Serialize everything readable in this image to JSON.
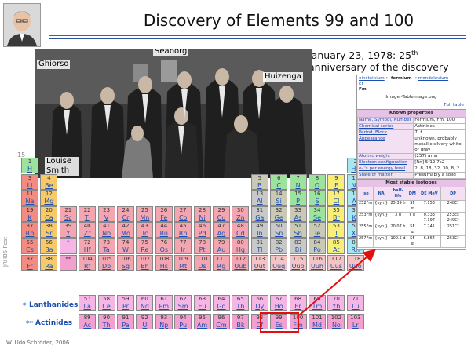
{
  "title": "Discovery of Elements 99 and 100",
  "anniversary": {
    "line1": "January 23, 1978: 25",
    "sup": "th",
    "line2": "anniversary of the discovery"
  },
  "photo_labels": {
    "ghiorso": "Ghiorso",
    "seaborg": "Seaborg",
    "huizenga": "Huizenga",
    "louise_smith": "Louise Smith"
  },
  "group_label": "15",
  "lanthanides_label": "Lanthanides",
  "actinides_label": "Actinides",
  "lanthanides_star": "*",
  "actinides_star": "**",
  "side_label": "JRH85-Fest",
  "credit": "W. Udo Schröder, 2006",
  "colors": {
    "accent_rule": "#c0303a",
    "rule2": "#3050a0",
    "highlight": "#e01010"
  },
  "elements": [
    {
      "n": "1",
      "s": "H",
      "c": "c-h",
      "col": 0,
      "row": 0
    },
    {
      "n": "2",
      "s": "He",
      "c": "c-ng",
      "col": 17,
      "row": 0
    },
    {
      "n": "3",
      "s": "Li",
      "c": "c-alk",
      "col": 0,
      "row": 1
    },
    {
      "n": "4",
      "s": "Be",
      "c": "c-ae",
      "col": 1,
      "row": 1
    },
    {
      "n": "5",
      "s": "B",
      "c": "c-met",
      "col": 12,
      "row": 1
    },
    {
      "n": "6",
      "s": "C",
      "c": "c-nm",
      "col": 13,
      "row": 1
    },
    {
      "n": "7",
      "s": "N",
      "c": "c-nm",
      "col": 14,
      "row": 1
    },
    {
      "n": "8",
      "s": "O",
      "c": "c-nm",
      "col": 15,
      "row": 1
    },
    {
      "n": "9",
      "s": "F",
      "c": "c-hal",
      "col": 16,
      "row": 1
    },
    {
      "n": "10",
      "s": "Ne",
      "c": "c-ng",
      "col": 17,
      "row": 1
    },
    {
      "n": "11",
      "s": "Na",
      "c": "c-alk",
      "col": 0,
      "row": 2
    },
    {
      "n": "12",
      "s": "Mg",
      "c": "c-ae",
      "col": 1,
      "row": 2
    },
    {
      "n": "13",
      "s": "Al",
      "c": "c-ptm",
      "col": 12,
      "row": 2
    },
    {
      "n": "14",
      "s": "Si",
      "c": "c-met",
      "col": 13,
      "row": 2
    },
    {
      "n": "15",
      "s": "P",
      "c": "c-nm",
      "col": 14,
      "row": 2
    },
    {
      "n": "16",
      "s": "S",
      "c": "c-nm",
      "col": 15,
      "row": 2
    },
    {
      "n": "17",
      "s": "Cl",
      "c": "c-hal",
      "col": 16,
      "row": 2
    },
    {
      "n": "18",
      "s": "Ar",
      "c": "c-ng",
      "col": 17,
      "row": 2
    },
    {
      "n": "19",
      "s": "K",
      "c": "c-alk",
      "col": 0,
      "row": 3
    },
    {
      "n": "20",
      "s": "Ca",
      "c": "c-ae",
      "col": 1,
      "row": 3
    },
    {
      "n": "21",
      "s": "Sc",
      "c": "c-tm",
      "col": 2,
      "row": 3
    },
    {
      "n": "22",
      "s": "Ti",
      "c": "c-tm",
      "col": 3,
      "row": 3
    },
    {
      "n": "23",
      "s": "V",
      "c": "c-tm",
      "col": 4,
      "row": 3
    },
    {
      "n": "24",
      "s": "Cr",
      "c": "c-tm",
      "col": 5,
      "row": 3
    },
    {
      "n": "25",
      "s": "Mn",
      "c": "c-tm",
      "col": 6,
      "row": 3
    },
    {
      "n": "26",
      "s": "Fe",
      "c": "c-tm",
      "col": 7,
      "row": 3
    },
    {
      "n": "27",
      "s": "Co",
      "c": "c-tm",
      "col": 8,
      "row": 3
    },
    {
      "n": "28",
      "s": "Ni",
      "c": "c-tm",
      "col": 9,
      "row": 3
    },
    {
      "n": "29",
      "s": "Cu",
      "c": "c-tm",
      "col": 10,
      "row": 3
    },
    {
      "n": "30",
      "s": "Zn",
      "c": "c-tm",
      "col": 11,
      "row": 3
    },
    {
      "n": "31",
      "s": "Ga",
      "c": "c-ptm",
      "col": 12,
      "row": 3
    },
    {
      "n": "32",
      "s": "Ge",
      "c": "c-met",
      "col": 13,
      "row": 3
    },
    {
      "n": "33",
      "s": "As",
      "c": "c-met",
      "col": 14,
      "row": 3
    },
    {
      "n": "34",
      "s": "Se",
      "c": "c-nm",
      "col": 15,
      "row": 3
    },
    {
      "n": "35",
      "s": "Br",
      "c": "c-hal",
      "col": 16,
      "row": 3
    },
    {
      "n": "36",
      "s": "Kr",
      "c": "c-ng",
      "col": 17,
      "row": 3
    },
    {
      "n": "37",
      "s": "Rb",
      "c": "c-alk",
      "col": 0,
      "row": 4
    },
    {
      "n": "38",
      "s": "Sr",
      "c": "c-ae",
      "col": 1,
      "row": 4
    },
    {
      "n": "39",
      "s": "Y",
      "c": "c-tm",
      "col": 2,
      "row": 4
    },
    {
      "n": "40",
      "s": "Zr",
      "c": "c-tm",
      "col": 3,
      "row": 4
    },
    {
      "n": "41",
      "s": "Nb",
      "c": "c-tm",
      "col": 4,
      "row": 4
    },
    {
      "n": "42",
      "s": "Mo",
      "c": "c-tm",
      "col": 5,
      "row": 4
    },
    {
      "n": "43",
      "s": "Tc",
      "c": "c-tm",
      "col": 6,
      "row": 4
    },
    {
      "n": "44",
      "s": "Ru",
      "c": "c-tm",
      "col": 7,
      "row": 4
    },
    {
      "n": "45",
      "s": "Rh",
      "c": "c-tm",
      "col": 8,
      "row": 4
    },
    {
      "n": "46",
      "s": "Pd",
      "c": "c-tm",
      "col": 9,
      "row": 4
    },
    {
      "n": "47",
      "s": "Ag",
      "c": "c-tm",
      "col": 10,
      "row": 4
    },
    {
      "n": "48",
      "s": "Cd",
      "c": "c-tm",
      "col": 11,
      "row": 4
    },
    {
      "n": "49",
      "s": "In",
      "c": "c-ptm",
      "col": 12,
      "row": 4
    },
    {
      "n": "50",
      "s": "Sn",
      "c": "c-ptm",
      "col": 13,
      "row": 4
    },
    {
      "n": "51",
      "s": "Sb",
      "c": "c-met",
      "col": 14,
      "row": 4
    },
    {
      "n": "52",
      "s": "Te",
      "c": "c-met",
      "col": 15,
      "row": 4
    },
    {
      "n": "53",
      "s": "I",
      "c": "c-hal",
      "col": 16,
      "row": 4
    },
    {
      "n": "54",
      "s": "Xe",
      "c": "c-ng",
      "col": 17,
      "row": 4
    },
    {
      "n": "55",
      "s": "Cs",
      "c": "c-alk",
      "col": 0,
      "row": 5
    },
    {
      "n": "56",
      "s": "Ba",
      "c": "c-ae",
      "col": 1,
      "row": 5
    },
    {
      "n": "*",
      "s": "",
      "c": "c-lan",
      "col": 2,
      "row": 5
    },
    {
      "n": "72",
      "s": "Hf",
      "c": "c-tm",
      "col": 3,
      "row": 5
    },
    {
      "n": "73",
      "s": "Ta",
      "c": "c-tm",
      "col": 4,
      "row": 5
    },
    {
      "n": "74",
      "s": "W",
      "c": "c-tm",
      "col": 5,
      "row": 5
    },
    {
      "n": "75",
      "s": "Re",
      "c": "c-tm",
      "col": 6,
      "row": 5
    },
    {
      "n": "76",
      "s": "Os",
      "c": "c-tm",
      "col": 7,
      "row": 5
    },
    {
      "n": "77",
      "s": "Ir",
      "c": "c-tm",
      "col": 8,
      "row": 5
    },
    {
      "n": "78",
      "s": "Pt",
      "c": "c-tm",
      "col": 9,
      "row": 5
    },
    {
      "n": "79",
      "s": "Au",
      "c": "c-tm",
      "col": 10,
      "row": 5
    },
    {
      "n": "80",
      "s": "Hg",
      "c": "c-tm",
      "col": 11,
      "row": 5
    },
    {
      "n": "81",
      "s": "Tl",
      "c": "c-ptm",
      "col": 12,
      "row": 5
    },
    {
      "n": "82",
      "s": "Pb",
      "c": "c-ptm",
      "col": 13,
      "row": 5
    },
    {
      "n": "83",
      "s": "Bi",
      "c": "c-ptm",
      "col": 14,
      "row": 5
    },
    {
      "n": "84",
      "s": "Po",
      "c": "c-met",
      "col": 15,
      "row": 5
    },
    {
      "n": "85",
      "s": "At",
      "c": "c-hal",
      "col": 16,
      "row": 5
    },
    {
      "n": "86",
      "s": "Rn",
      "c": "c-ng",
      "col": 17,
      "row": 5
    },
    {
      "n": "87",
      "s": "Fr",
      "c": "c-alk",
      "col": 0,
      "row": 6
    },
    {
      "n": "88",
      "s": "Ra",
      "c": "c-ae",
      "col": 1,
      "row": 6
    },
    {
      "n": "**",
      "s": "",
      "c": "c-act",
      "col": 2,
      "row": 6
    },
    {
      "n": "104",
      "s": "Rf",
      "c": "c-tm",
      "col": 3,
      "row": 6
    },
    {
      "n": "105",
      "s": "Db",
      "c": "c-tm",
      "col": 4,
      "row": 6
    },
    {
      "n": "106",
      "s": "Sg",
      "c": "c-tm",
      "col": 5,
      "row": 6
    },
    {
      "n": "107",
      "s": "Bh",
      "c": "c-tm",
      "col": 6,
      "row": 6
    },
    {
      "n": "108",
      "s": "Hs",
      "c": "c-tm",
      "col": 7,
      "row": 6
    },
    {
      "n": "109",
      "s": "Mt",
      "c": "c-tm",
      "col": 8,
      "row": 6
    },
    {
      "n": "110",
      "s": "Ds",
      "c": "c-tm",
      "col": 9,
      "row": 6
    },
    {
      "n": "111",
      "s": "Rg",
      "c": "c-tm",
      "col": 10,
      "row": 6
    },
    {
      "n": "112",
      "s": "Uub",
      "c": "c-tm",
      "col": 11,
      "row": 6
    },
    {
      "n": "113",
      "s": "Uut",
      "c": "c-unk",
      "col": 12,
      "row": 6
    },
    {
      "n": "114",
      "s": "Uuq",
      "c": "c-unk",
      "col": 13,
      "row": 6
    },
    {
      "n": "115",
      "s": "Uup",
      "c": "c-unk",
      "col": 14,
      "row": 6
    },
    {
      "n": "116",
      "s": "Uuh",
      "c": "c-unk",
      "col": 15,
      "row": 6
    },
    {
      "n": "117",
      "s": "Uus",
      "c": "c-unk",
      "col": 16,
      "row": 6
    },
    {
      "n": "118",
      "s": "Uuo",
      "c": "c-unk",
      "col": 17,
      "row": 6
    },
    {
      "n": "57",
      "s": "La",
      "c": "c-lan",
      "col": 3,
      "row": 8
    },
    {
      "n": "58",
      "s": "Ce",
      "c": "c-lan",
      "col": 4,
      "row": 8
    },
    {
      "n": "59",
      "s": "Pr",
      "c": "c-lan",
      "col": 5,
      "row": 8
    },
    {
      "n": "60",
      "s": "Nd",
      "c": "c-lan",
      "col": 6,
      "row": 8
    },
    {
      "n": "61",
      "s": "Pm",
      "c": "c-lan",
      "col": 7,
      "row": 8
    },
    {
      "n": "62",
      "s": "Sm",
      "c": "c-lan",
      "col": 8,
      "row": 8
    },
    {
      "n": "63",
      "s": "Eu",
      "c": "c-lan",
      "col": 9,
      "row": 8
    },
    {
      "n": "64",
      "s": "Gd",
      "c": "c-lan",
      "col": 10,
      "row": 8
    },
    {
      "n": "65",
      "s": "Tb",
      "c": "c-lan",
      "col": 11,
      "row": 8
    },
    {
      "n": "66",
      "s": "Dy",
      "c": "c-lan",
      "col": 12,
      "row": 8
    },
    {
      "n": "67",
      "s": "Ho",
      "c": "c-lan",
      "col": 13,
      "row": 8
    },
    {
      "n": "68",
      "s": "Er",
      "c": "c-lan",
      "col": 14,
      "row": 8
    },
    {
      "n": "69",
      "s": "Tm",
      "c": "c-lan",
      "col": 15,
      "row": 8
    },
    {
      "n": "70",
      "s": "Yb",
      "c": "c-lan",
      "col": 16,
      "row": 8
    },
    {
      "n": "71",
      "s": "Lu",
      "c": "c-lan",
      "col": 17,
      "row": 8
    },
    {
      "n": "89",
      "s": "Ac",
      "c": "c-act",
      "col": 3,
      "row": 9
    },
    {
      "n": "90",
      "s": "Th",
      "c": "c-act",
      "col": 4,
      "row": 9
    },
    {
      "n": "91",
      "s": "Pa",
      "c": "c-act",
      "col": 5,
      "row": 9
    },
    {
      "n": "92",
      "s": "U",
      "c": "c-act",
      "col": 6,
      "row": 9
    },
    {
      "n": "93",
      "s": "Np",
      "c": "c-act",
      "col": 7,
      "row": 9
    },
    {
      "n": "94",
      "s": "Pu",
      "c": "c-act",
      "col": 8,
      "row": 9
    },
    {
      "n": "95",
      "s": "Am",
      "c": "c-act",
      "col": 9,
      "row": 9
    },
    {
      "n": "96",
      "s": "Cm",
      "c": "c-act",
      "col": 10,
      "row": 9
    },
    {
      "n": "97",
      "s": "Bk",
      "c": "c-act",
      "col": 11,
      "row": 9
    },
    {
      "n": "98",
      "s": "Cf",
      "c": "c-act",
      "col": 12,
      "row": 9
    },
    {
      "n": "99",
      "s": "Es",
      "c": "c-act",
      "col": 13,
      "row": 9
    },
    {
      "n": "100",
      "s": "Fm",
      "c": "c-act",
      "col": 14,
      "row": 9
    },
    {
      "n": "101",
      "s": "Md",
      "c": "c-act",
      "col": 15,
      "row": 9
    },
    {
      "n": "102",
      "s": "No",
      "c": "c-act",
      "col": 16,
      "row": 9
    },
    {
      "n": "103",
      "s": "Lr",
      "c": "c-act",
      "col": 17,
      "row": 9
    }
  ],
  "wiki": {
    "nav_prev": "einsteinium",
    "nav_cur": "fermium",
    "nav_next": "mendelevium",
    "er": "Er",
    "sym": "Fm",
    "image_caption": "Image:-Tableimage.png",
    "full_table": "Full table",
    "known_props": "Known properties",
    "props": [
      {
        "k": "Name, Symbol, Number",
        "v": "Fermium, Fm, 100"
      },
      {
        "k": "Chemical series",
        "v": "Actinides"
      },
      {
        "k": "Period, Block",
        "v": "7, f"
      },
      {
        "k": "Appearance",
        "v": "unknown, probably metallic silvery white or gray"
      },
      {
        "k": "Atomic weight",
        "v": "(257) amu"
      },
      {
        "k": "Electron configuration",
        "v": "[Rn] 5f12 7s2"
      },
      {
        "k": "e- 's per energy level",
        "v": "2, 8, 18, 32, 30, 8, 2"
      },
      {
        "k": "State of matter",
        "v": "Presumably a solid"
      }
    ],
    "stable_isotopes": "Most stable isotopes",
    "iso_headers": [
      "iso",
      "NA",
      "half-life",
      "DM",
      "DE MeV",
      "DP"
    ],
    "isotopes": [
      {
        "iso": "252Fm",
        "na": "{syn.}",
        "hl": "25.39 h",
        "dm": "SF α",
        "de": "7.153",
        "dp": "248Cf"
      },
      {
        "iso": "253Fm",
        "na": "{syn.}",
        "hl": "3 d",
        "dm": "ε α",
        "de": "0.333 7.197",
        "dp": "253Es 249Cf"
      },
      {
        "iso": "255Fm",
        "na": "{syn.}",
        "hl": "20.07 h",
        "dm": "SF α",
        "de": "7.241",
        "dp": "251Cf"
      },
      {
        "iso": "257Fm",
        "na": "{syn.}",
        "hl": "100.5 d",
        "dm": "SF α",
        "de": "6.864",
        "dp": "253Cf"
      }
    ]
  }
}
